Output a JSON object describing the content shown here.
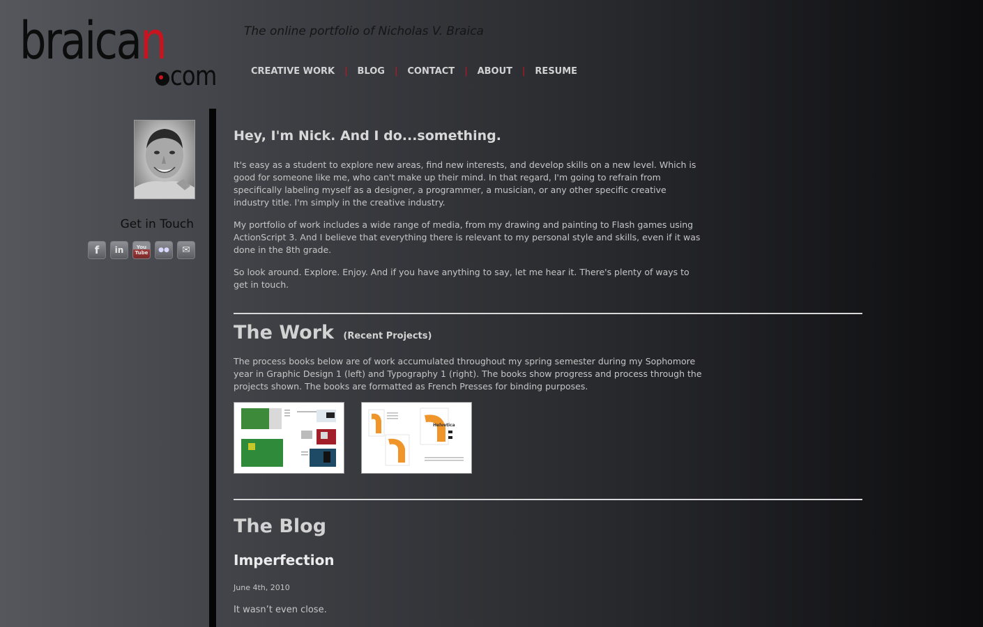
{
  "site": {
    "logo_main": "braica",
    "logo_accent": "n",
    "logo_suffix": "com",
    "tagline": "The online portfolio of Nicholas V. Braica"
  },
  "nav": {
    "items": [
      {
        "label": "CREATIVE WORK"
      },
      {
        "label": "BLOG"
      },
      {
        "label": "CONTACT"
      },
      {
        "label": "ABOUT"
      },
      {
        "label": "RESUME"
      }
    ],
    "separator": "|"
  },
  "sidebar": {
    "get_in_touch": "Get in Touch",
    "social": [
      {
        "name": "facebook-icon",
        "glyph": "f"
      },
      {
        "name": "linkedin-icon",
        "glyph": "in"
      },
      {
        "name": "youtube-icon",
        "glyph": "You Tube"
      },
      {
        "name": "flickr-icon",
        "glyph": "●●"
      },
      {
        "name": "email-icon",
        "glyph": "✉"
      }
    ]
  },
  "intro": {
    "heading": "Hey, I'm Nick. And I do...something.",
    "paragraphs": [
      "It's easy as a student to explore new areas, find new interests, and develop skills on a new level. Which is good for someone like me, who can't make up their mind. In that regard, I'm going to refrain from specifically labeling myself as a designer, a programmer, a musician, or any other specific creative industry title. I'm simply in the creative industry.",
      "My portfolio of work includes a wide range of media, from my drawing and painting to Flash games using ActionScript 3. And I believe that everything there is relevant to my personal style and skills, even if it was done in the 8th grade.",
      "So look around. Explore. Enjoy. And if you have anything to say, let me hear it. There's plenty of ways to get in touch."
    ]
  },
  "work": {
    "title": "The Work",
    "subtitle": "(Recent Projects)",
    "description": "The process books below are of work accumulated throughout my spring semester during my Sophomore year in Graphic Design 1 (left) and Typography 1 (right). The books show progress and process through the projects shown. The books are formatted as French Presses for binding purposes.",
    "thumb_right_label": "Helvetica"
  },
  "blog": {
    "title": "The Blog",
    "post_title": "Imperfection",
    "post_date": "June 4th, 2010",
    "post_body": "It wasn’t even close."
  }
}
